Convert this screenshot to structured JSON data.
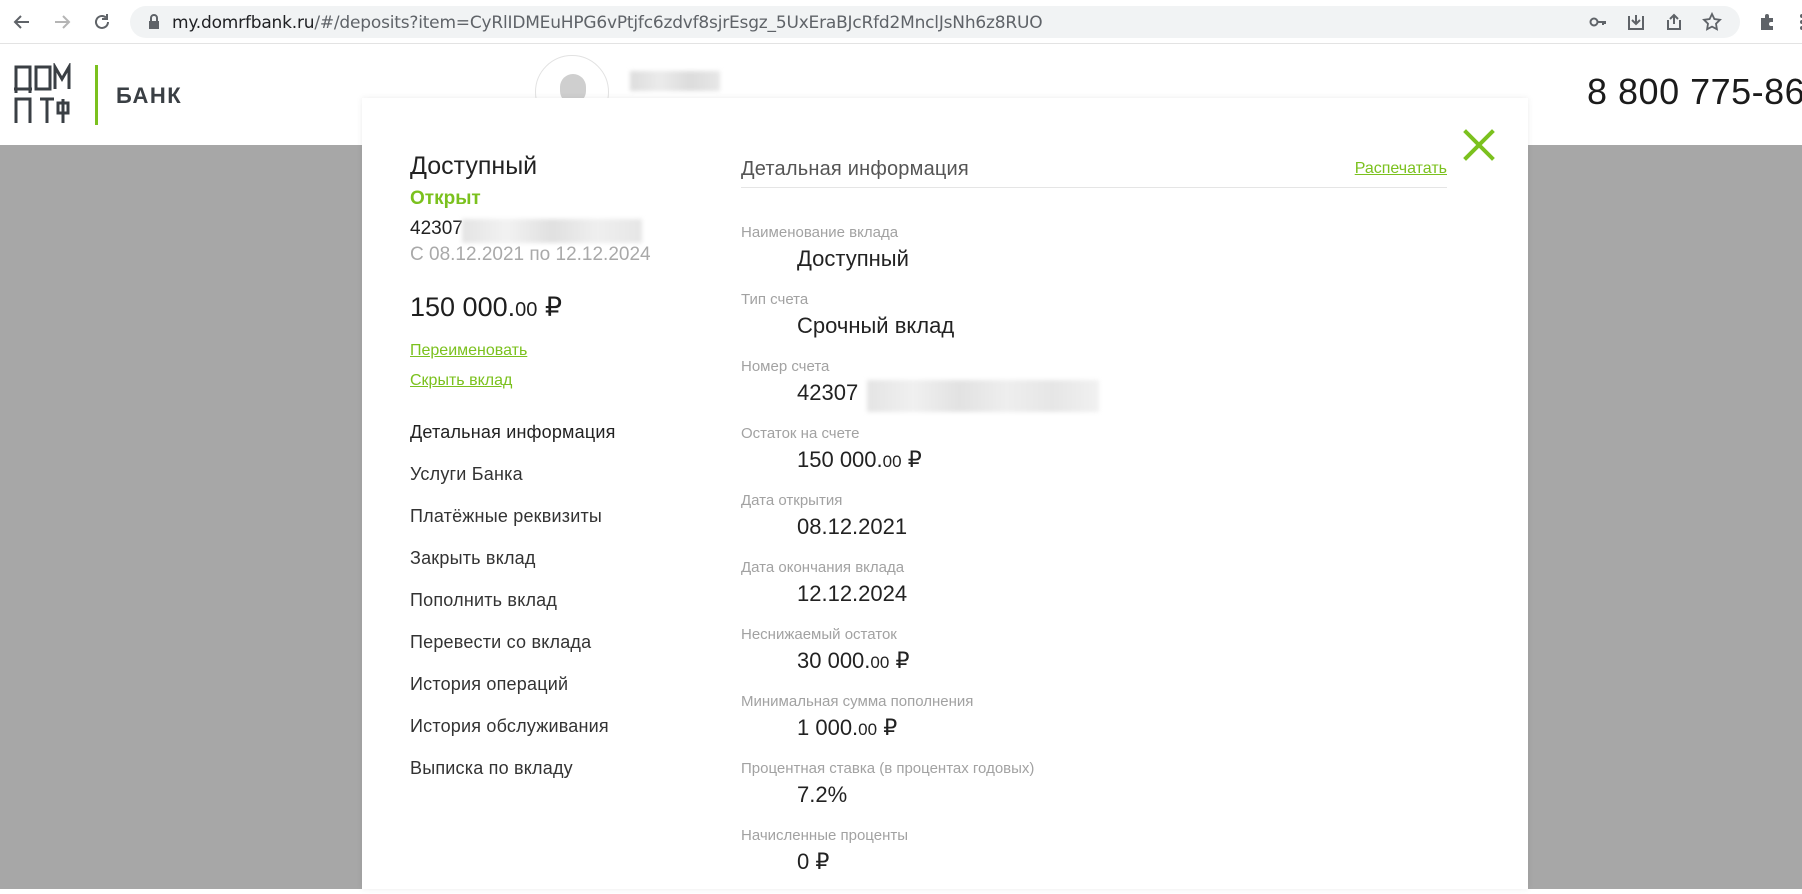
{
  "browser": {
    "url_host": "my.domrfbank.ru",
    "url_path": "/#/deposits?item=CyRlIDMEuHPG6vPtjfc6zdvf8sjrEsgz_5UxEraBJcRfd2MnclJsNh6z8RUO"
  },
  "header": {
    "bank_label": "БАНК",
    "phone": "8 800 775-86"
  },
  "deposit": {
    "title": "Доступный",
    "status": "Открыт",
    "account_prefix": "42307",
    "period": "С 08.12.2021 по 12.12.2024",
    "amount_main": "150 000.",
    "amount_kop": "00",
    "currency": "₽",
    "rename_link": "Переименовать",
    "hide_link": "Скрыть вклад"
  },
  "menu": [
    "Детальная информация",
    "Услуги Банка",
    "Платёжные реквизиты",
    "Закрыть вклад",
    "Пополнить вклад",
    "Перевести со вклада",
    "История операций",
    "История обслуживания",
    "Выписка по вкладу"
  ],
  "details": {
    "title": "Детальная информация",
    "print_link": "Распечатать",
    "fields": [
      {
        "label": "Наименование вклада",
        "value": "Доступный"
      },
      {
        "label": "Тип счета",
        "value": "Срочный вклад"
      },
      {
        "label": "Номер счета",
        "value": "42307"
      },
      {
        "label": "Остаток на счете",
        "value_main": "150 000.",
        "value_kop": "00",
        "currency": "₽"
      },
      {
        "label": "Дата открытия",
        "value": "08.12.2021"
      },
      {
        "label": "Дата окончания вклада",
        "value": "12.12.2024"
      },
      {
        "label": "Неснижаемый остаток",
        "value_main": "30 000.",
        "value_kop": "00",
        "currency": "₽"
      },
      {
        "label": "Минимальная сумма пополнения",
        "value_main": "1 000.",
        "value_kop": "00",
        "currency": "₽"
      },
      {
        "label": "Процентная ставка (в процентах годовых)",
        "value": "7.2%"
      },
      {
        "label": "Начисленные проценты",
        "value": "0 ₽"
      }
    ]
  },
  "colors": {
    "accent_green": "#7bc11e",
    "overlay_gray": "#a7a7a7"
  }
}
